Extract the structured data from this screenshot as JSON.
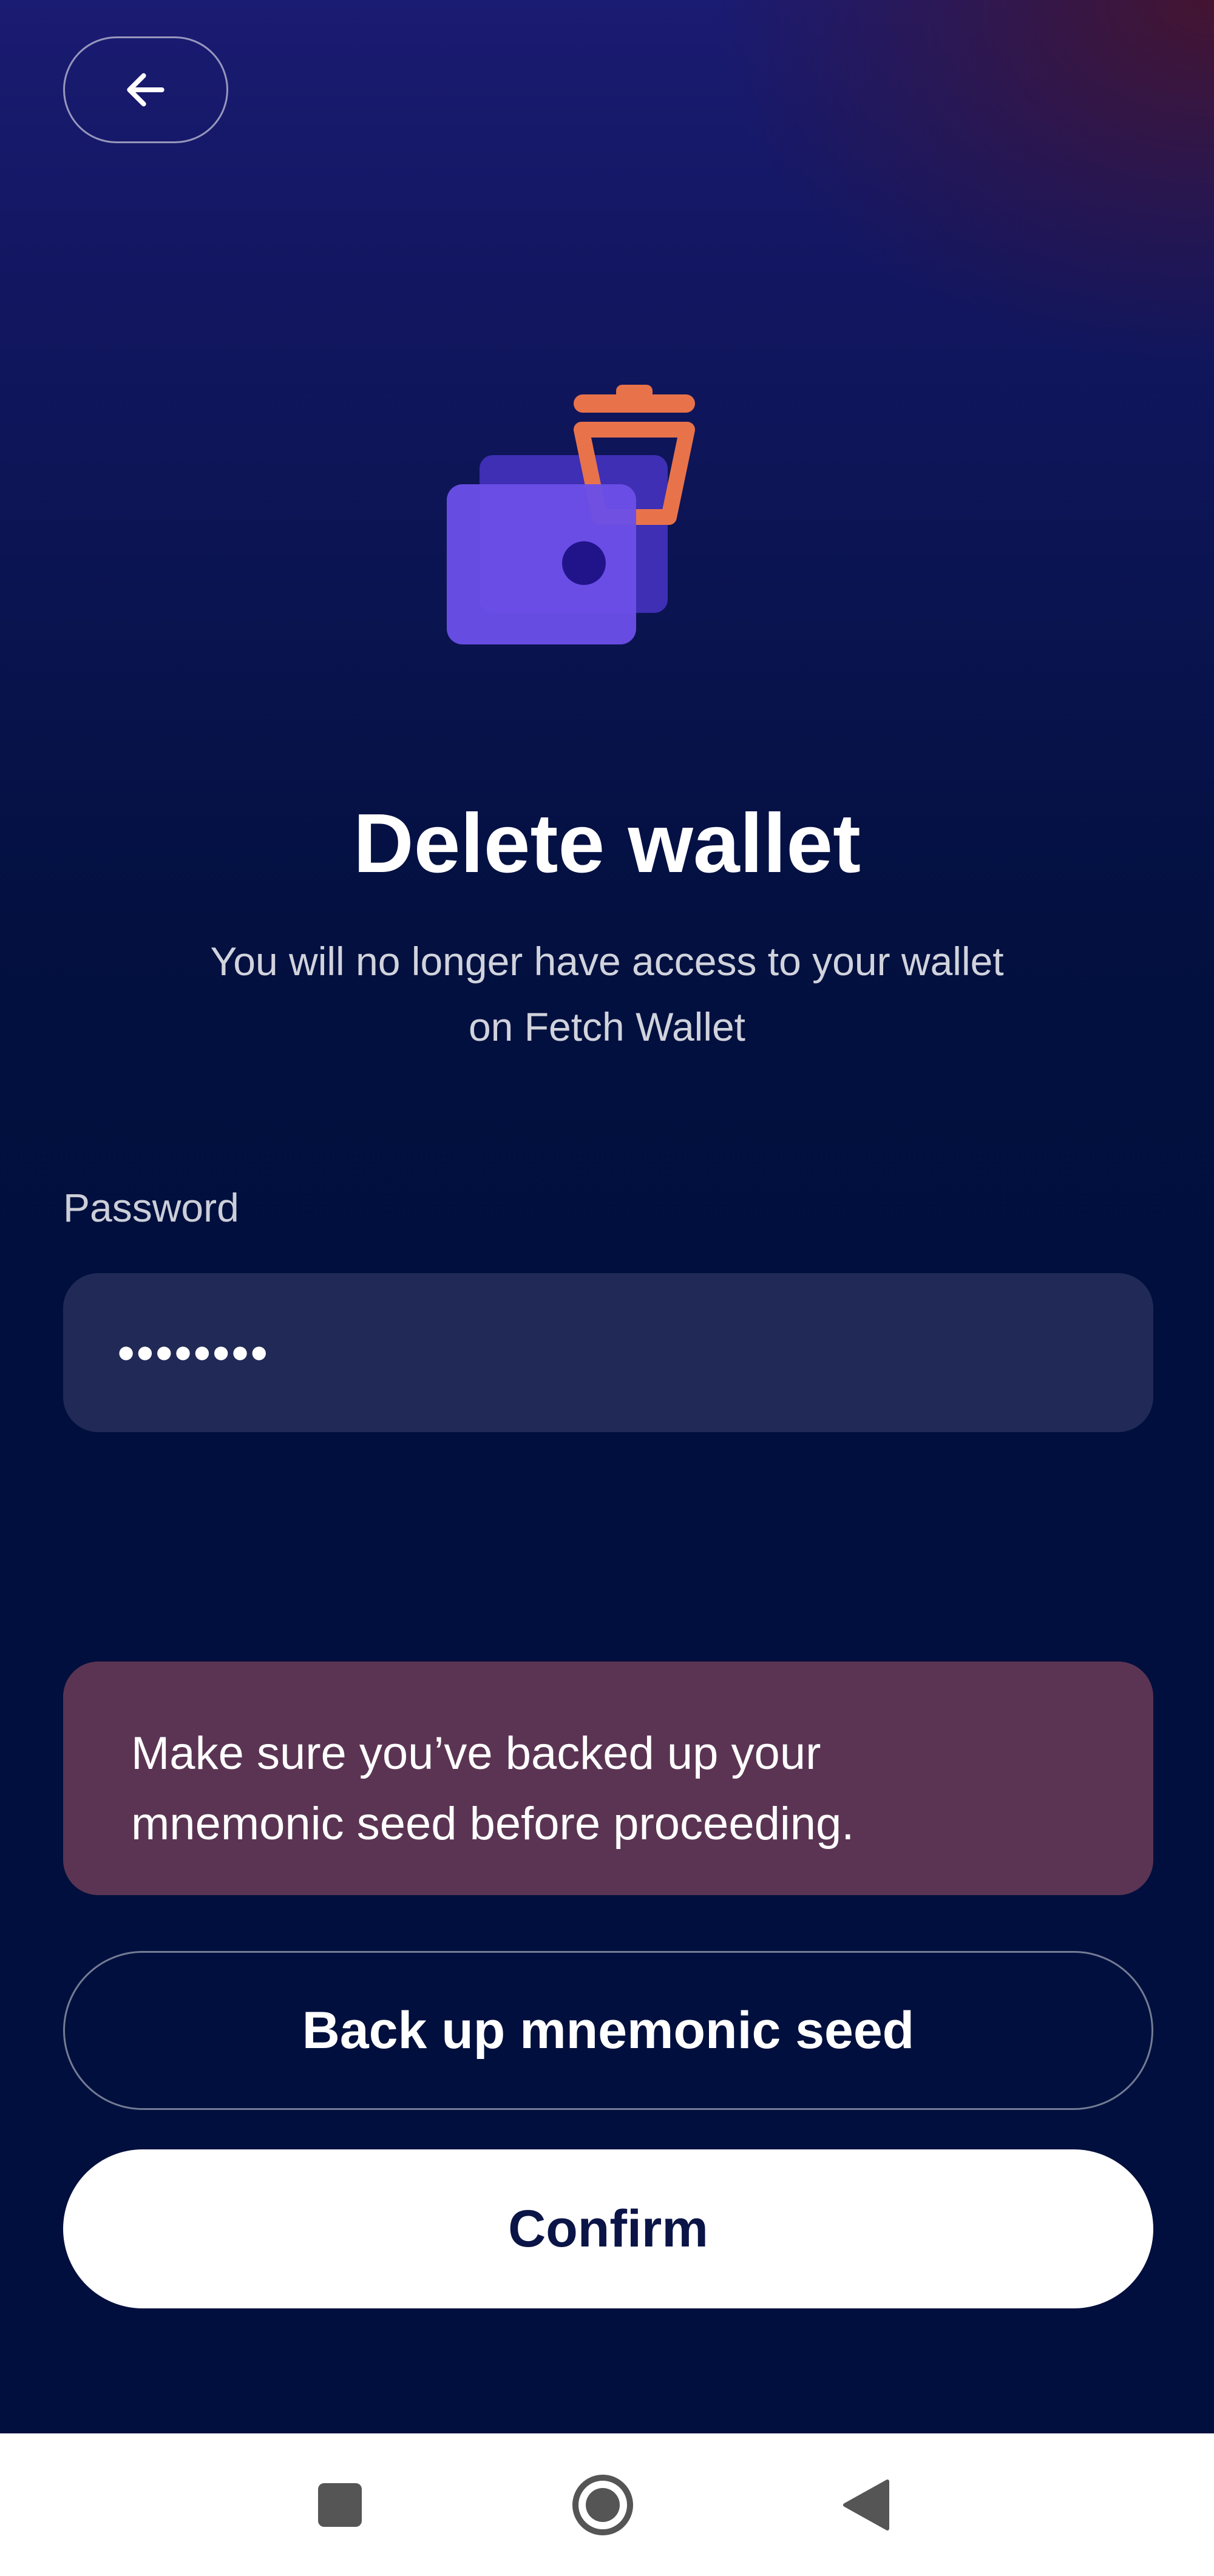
{
  "header": {
    "back_icon": "arrow-left-icon"
  },
  "hero": {
    "icon": "wallet-trash-icon",
    "colors": {
      "wallet": "#6a4ee6",
      "trash": "#e8734a"
    }
  },
  "title": "Delete wallet",
  "subtitle": {
    "line1": "You will no longer have access to your wallet",
    "line2": "on Fetch Wallet"
  },
  "password": {
    "label": "Password",
    "value": "••••••••"
  },
  "warning": {
    "line1": "Make sure you’ve backed up your",
    "line2": "mnemonic seed before proceeding.",
    "color": "#5b3453"
  },
  "buttons": {
    "backup_label": "Back up mnemonic seed",
    "confirm_label": "Confirm"
  },
  "nav": {
    "recents_icon": "square-icon",
    "home_icon": "circle-home-icon",
    "back_icon": "triangle-back-icon"
  }
}
